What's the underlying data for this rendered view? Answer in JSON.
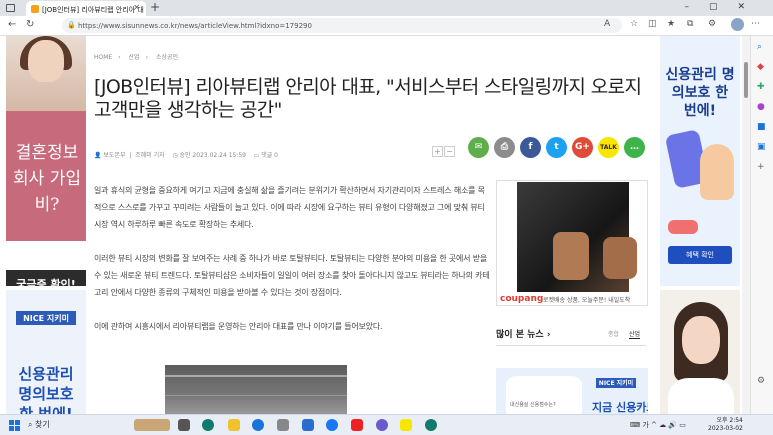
{
  "browser": {
    "tab_title": "[JOB인터뷰] 리아뷰티랩 안리아 대",
    "url": "https://www.sisunnews.co.kr/news/articleView.html?idxno=179290"
  },
  "breadcrumb": [
    "HOME",
    "산업",
    "소상공인"
  ],
  "article": {
    "title": "[JOB인터뷰] 리아뷰티랩 안리아 대표, \"서비스부터 스타일링까지 오로지 고객만을 생각하는 공간\"",
    "author": "보도본부",
    "reporter_label": "조혜미 기자",
    "date": "승인 2023.02.24 15:59",
    "comments": "댓글 0",
    "font_up": "+",
    "font_down": "−",
    "paragraphs": [
      "일과 휴식의 균형을 중요하게 여기고 지금에 충실해 삶을 즐기려는 분위기가 확산하면서 자기관리이자 스트레스 해소를 목적으로 스스로를 가꾸고 꾸미려는 사람들이 늘고 있다. 이에 따라 시장에 요구하는 뷰티 유형이 다양해졌고 그에 맞춰 뷰티 시장 역시 하루하루 빠른 속도로 확장하는 추세다.",
      "이러한 뷰티 시장의 변화를 잘 보여주는 사례 중 하나가 바로 토탈뷰티다. 토탈뷰티는 다양한 분야의 미용을 한 곳에서 받을 수 있는 새로운 뷰티 트렌드다. 토탈뷰티샵은 소비자들이 일일이 여러 장소를 찾아 돌아다니지 않고도 뷰티라는 하나의 카테고리 안에서 다양한 종류의 구체적인 미용을 받아볼 수 있다는 것이 장점이다.",
      "이에 관하여 시흥시에서 리아뷰티랩을 운영하는 안리아 대표를 만나 이야기를 들어보았다."
    ]
  },
  "share_buttons": [
    {
      "name": "email",
      "label": "✉",
      "color": "#5fae4b"
    },
    {
      "name": "print",
      "label": "⎙",
      "color": "#8c8c8c"
    },
    {
      "name": "facebook",
      "label": "f",
      "color": "#3b5998"
    },
    {
      "name": "twitter",
      "label": "t",
      "color": "#1da1f2"
    },
    {
      "name": "googleplus",
      "label": "G+",
      "color": "#dd4b39"
    },
    {
      "name": "kakaotalk",
      "label": "TALK",
      "color": "#f7e600"
    },
    {
      "name": "message",
      "label": "…",
      "color": "#3db34a"
    }
  ],
  "left_ad": {
    "pink_text": "결혼정보 회사 가입비?",
    "button": "궁금증 확인!"
  },
  "left_ad2": {
    "brand": "NICE 지키미",
    "text": "신용관리 명의보호 한 번에!"
  },
  "coupang": {
    "logo": "coupang",
    "text": "로켓배송 상품, 오늘주문! 내일도착"
  },
  "popular": {
    "heading": "많이 본 뉴스",
    "tab_all": "종합",
    "tab_industry": "산업"
  },
  "right_ad": {
    "brand": "NICE 지키미",
    "text": "지금 신용카드",
    "small": "내신용실 신용점수는?"
  },
  "far_ad1": {
    "text": "신용관리 명의보호 한 번에!",
    "cta": "혜택 확인"
  },
  "taskbar": {
    "search": "찾기",
    "time": "오후 2:54",
    "date": "2023-03-02"
  }
}
